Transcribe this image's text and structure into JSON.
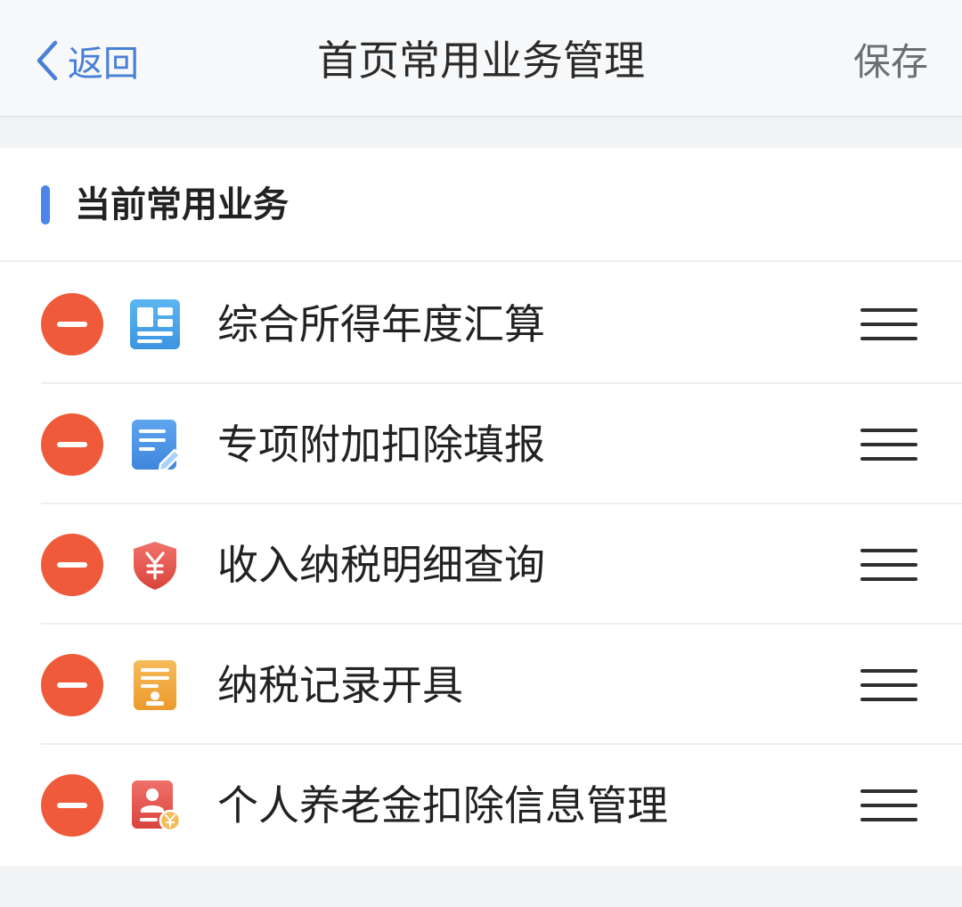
{
  "navbar": {
    "back_label": "返回",
    "title": "首页常用业务管理",
    "save_label": "保存"
  },
  "section": {
    "title": "当前常用业务"
  },
  "items": [
    {
      "label": "综合所得年度汇算",
      "icon": "annual-settlement-icon",
      "icon_color": "#4aa5ea"
    },
    {
      "label": "专项附加扣除填报",
      "icon": "edit-form-icon",
      "icon_color": "#4a90e2"
    },
    {
      "label": "收入纳税明细查询",
      "icon": "yuan-shield-icon",
      "icon_color": "#e8544c"
    },
    {
      "label": "纳税记录开具",
      "icon": "certificate-icon",
      "icon_color": "#f0a43a"
    },
    {
      "label": "个人养老金扣除信息管理",
      "icon": "pension-card-icon",
      "icon_color": "#e8544c"
    }
  ],
  "colors": {
    "accent": "#4a86e8",
    "remove": "#ef5b3a"
  }
}
